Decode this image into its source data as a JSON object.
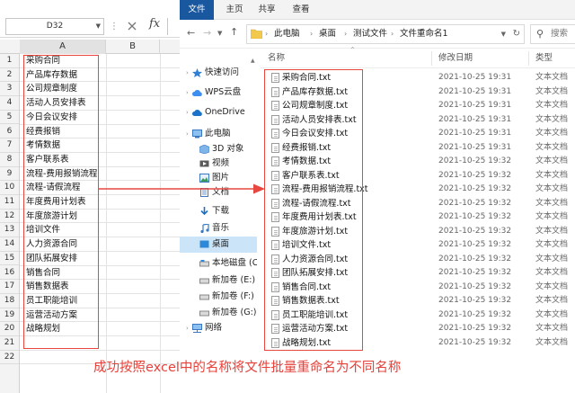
{
  "excel": {
    "name_box": "D32",
    "fx_label": "fx",
    "columns": [
      "A",
      "B"
    ],
    "rows": [
      "1",
      "2",
      "3",
      "4",
      "5",
      "6",
      "7",
      "8",
      "9",
      "10",
      "11",
      "12",
      "13",
      "14",
      "15",
      "16",
      "17",
      "18",
      "19",
      "20",
      "21",
      "22"
    ],
    "cells": [
      "采购合同",
      "产品库存数据",
      "公司规章制度",
      "活动人员安排表",
      "今日会议安排",
      "经费报销",
      "考情数据",
      "客户联系表",
      "流程-费用报销流程",
      "流程-请假流程",
      "年度费用计划表",
      "年度旅游计划",
      "培训文件",
      "人力资源合同",
      "团队拓展安排",
      "销售合同",
      "销售数据表",
      "员工职能培训",
      "运营活动方案",
      "战略规划"
    ]
  },
  "explorer": {
    "ribbon_tabs": [
      "文件",
      "主页",
      "共享",
      "查看"
    ],
    "breadcrumb": [
      "此电脑",
      "桌面",
      "测试文件",
      "文件重命名1"
    ],
    "search_placeholder": "搜索",
    "nav_items": [
      "快速访问",
      "WPS云盘",
      "OneDrive",
      "此电脑",
      "3D 对象",
      "视频",
      "图片",
      "文档",
      "下载",
      "音乐",
      "桌面",
      "本地磁盘 (C",
      "新加卷 (E:)",
      "新加卷 (F:)",
      "新加卷 (G:)",
      "网络"
    ],
    "selected_nav": "桌面",
    "headers": {
      "name": "名称",
      "date": "修改日期",
      "type": "类型"
    },
    "files": [
      {
        "name": "采购合同.txt",
        "date": "2021-10-25 19:31",
        "type": "文本文档"
      },
      {
        "name": "产品库存数据.txt",
        "date": "2021-10-25 19:31",
        "type": "文本文档"
      },
      {
        "name": "公司规章制度.txt",
        "date": "2021-10-25 19:31",
        "type": "文本文档"
      },
      {
        "name": "活动人员安排表.txt",
        "date": "2021-10-25 19:31",
        "type": "文本文档"
      },
      {
        "name": "今日会议安排.txt",
        "date": "2021-10-25 19:31",
        "type": "文本文档"
      },
      {
        "name": "经费报销.txt",
        "date": "2021-10-25 19:31",
        "type": "文本文档"
      },
      {
        "name": "考情数据.txt",
        "date": "2021-10-25 19:32",
        "type": "文本文档"
      },
      {
        "name": "客户联系表.txt",
        "date": "2021-10-25 19:32",
        "type": "文本文档"
      },
      {
        "name": "流程-费用报销流程.txt",
        "date": "2021-10-25 19:32",
        "type": "文本文档"
      },
      {
        "name": "流程-请假流程.txt",
        "date": "2021-10-25 19:32",
        "type": "文本文档"
      },
      {
        "name": "年度费用计划表.txt",
        "date": "2021-10-25 19:32",
        "type": "文本文档"
      },
      {
        "name": "年度旅游计划.txt",
        "date": "2021-10-25 19:32",
        "type": "文本文档"
      },
      {
        "name": "培训文件.txt",
        "date": "2021-10-25 19:32",
        "type": "文本文档"
      },
      {
        "name": "人力资源合同.txt",
        "date": "2021-10-25 19:32",
        "type": "文本文档"
      },
      {
        "name": "团队拓展安排.txt",
        "date": "2021-10-25 19:32",
        "type": "文本文档"
      },
      {
        "name": "销售合同.txt",
        "date": "2021-10-25 19:32",
        "type": "文本文档"
      },
      {
        "name": "销售数据表.txt",
        "date": "2021-10-25 19:32",
        "type": "文本文档"
      },
      {
        "name": "员工职能培训.txt",
        "date": "2021-10-25 19:32",
        "type": "文本文档"
      },
      {
        "name": "运营活动方案.txt",
        "date": "2021-10-25 19:32",
        "type": "文本文档"
      },
      {
        "name": "战略规划.txt",
        "date": "2021-10-25 19:32",
        "type": "文本文档"
      }
    ]
  },
  "caption": "成功按照excel中的名称将文件批量重命名为不同名称",
  "colors": {
    "annotation_red": "#e8473f",
    "ribbon_blue": "#19579f",
    "selection_blue": "#cce4f7"
  }
}
